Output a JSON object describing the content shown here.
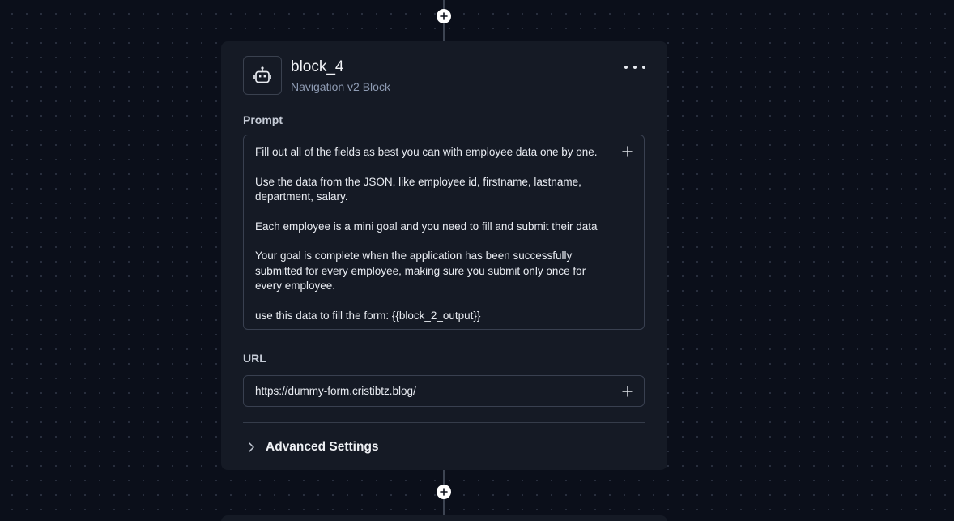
{
  "block": {
    "title": "block_4",
    "subtitle": "Navigation v2 Block",
    "icon": "robot-icon"
  },
  "menu": {
    "icon": "more-horizontal-icon"
  },
  "prompt": {
    "label": "Prompt",
    "paragraphs": [
      "Fill out all of the fields as best you can with employee data one by one.",
      "Use the data from the JSON, like employee id, firstname, lastname, department, salary.",
      "Each employee is a mini goal and you need to fill and submit their data",
      "Your goal is complete when the application has been successfully submitted for every employee, making sure you submit only once for every employee.",
      "use this data to fill the form: {{block_2_output}}"
    ]
  },
  "url": {
    "label": "URL",
    "value": "https://dummy-form.cristibtz.blog/"
  },
  "advanced": {
    "label": "Advanced Settings",
    "icon": "chevron-right-icon"
  },
  "colors": {
    "canvas": "#0b0f1a",
    "card": "#151a25",
    "border": "#394050",
    "muted_text": "#8e9bb3"
  }
}
